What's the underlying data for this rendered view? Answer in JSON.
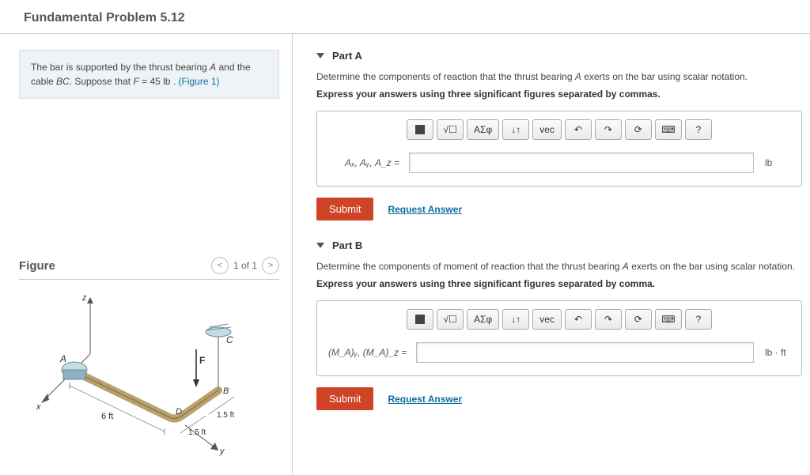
{
  "title": "Fundamental Problem 5.12",
  "intro": {
    "line1a": "The bar is supported by the thrust bearing ",
    "varA": "A",
    "line1b": " and the cable ",
    "varBC": "BC",
    "line2a": ". Suppose that ",
    "varF": "F",
    "line2b": " = 45 lb . ",
    "figlink": "(Figure 1)"
  },
  "figure": {
    "heading": "Figure",
    "pager": "1 of 1",
    "labels": {
      "z": "z",
      "x": "x",
      "y": "y",
      "A": "A",
      "C": "C",
      "F": "F",
      "B": "B",
      "D": "D",
      "d6": "6 ft",
      "d15a": "1.5 ft",
      "d15b": "1.5 ft"
    }
  },
  "toolbar": {
    "tmpl": "▭",
    "sqrt": "√☐",
    "greek": "ΑΣφ",
    "subsup": "↓↑",
    "vec": "vec",
    "undo": "↶",
    "redo": "↷",
    "reset": "⟳",
    "kbd": "⌨",
    "help": "?"
  },
  "partA": {
    "title": "Part A",
    "desc1": "Determine the components of reaction that the thrust bearing ",
    "descVar": "A",
    "desc2": " exerts on the bar using scalar notation.",
    "instruct": "Express your answers using three significant figures separated by commas.",
    "lhs": "Aₓ, Aᵧ, A_z =",
    "unit": "lb",
    "submit": "Submit",
    "request": "Request Answer"
  },
  "partB": {
    "title": "Part B",
    "desc1": "Determine the components of moment of reaction that the thrust bearing ",
    "descVar": "A",
    "desc2": " exerts on the bar using scalar notation.",
    "instruct": "Express your answers using three significant figures separated by comma.",
    "lhs": "(M_A)ᵧ, (M_A)_z =",
    "unit": "lb · ft",
    "submit": "Submit",
    "request": "Request Answer"
  }
}
